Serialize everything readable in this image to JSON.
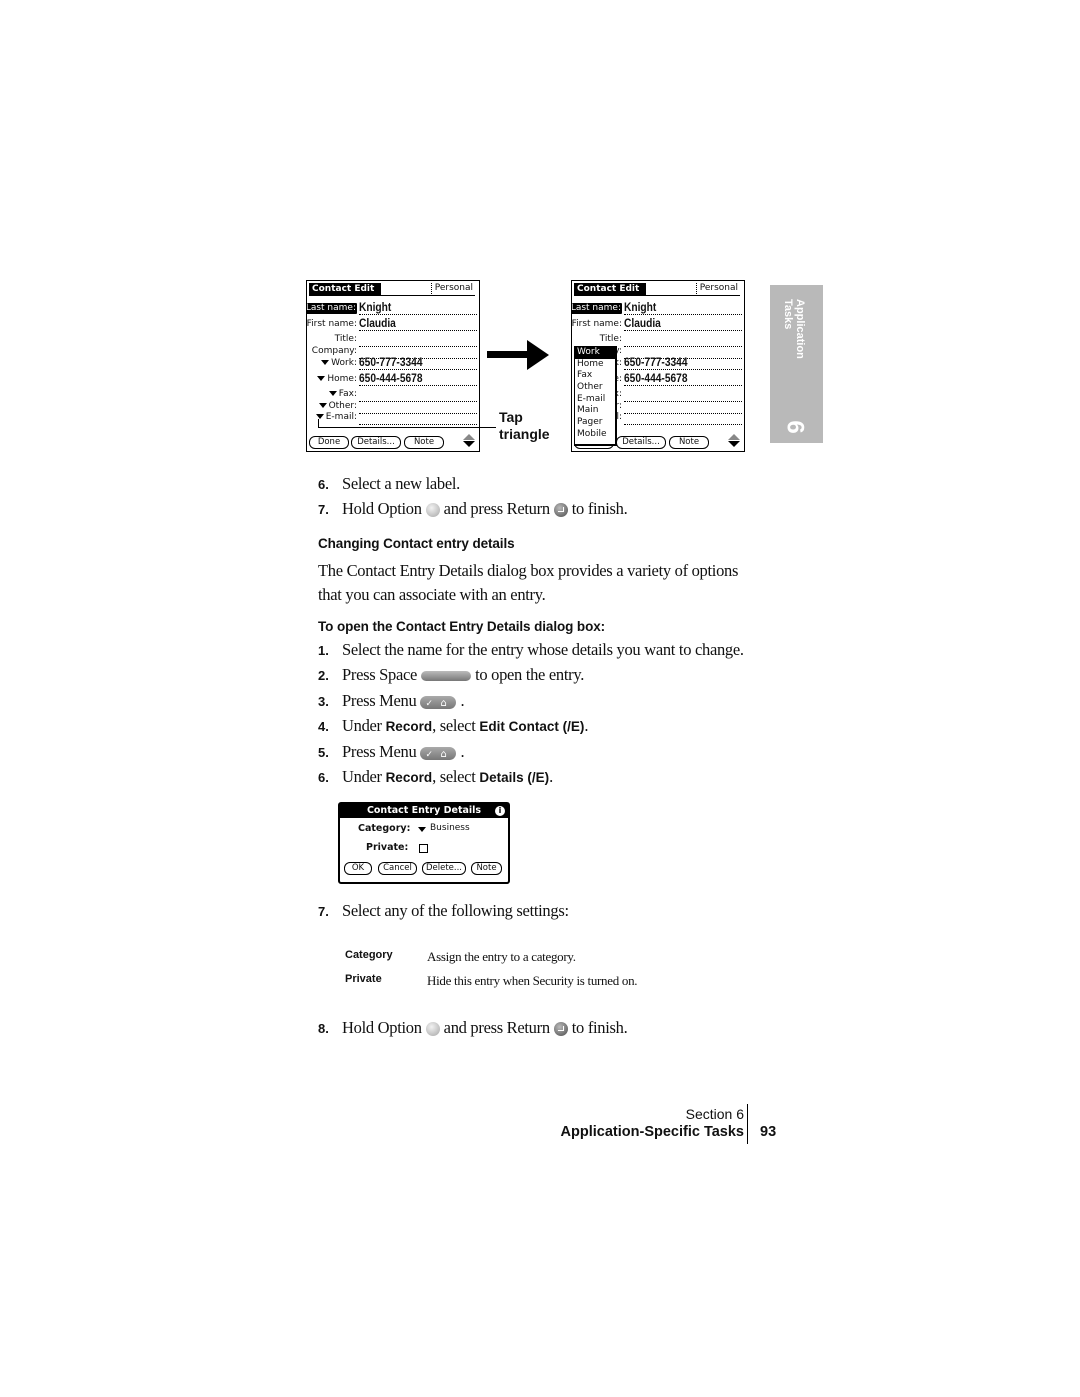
{
  "screens": {
    "left": {
      "title": "Contact Edit",
      "category": "Personal",
      "fields": [
        {
          "label": "Last name:",
          "value": "Knight",
          "highlight": true,
          "triangle": false
        },
        {
          "label": "First name:",
          "value": "Claudia",
          "highlight": false,
          "triangle": false
        },
        {
          "label": "Title:",
          "value": "",
          "highlight": false,
          "triangle": false
        },
        {
          "label": "Company:",
          "value": "",
          "highlight": false,
          "triangle": false
        },
        {
          "label": "Work:",
          "value": "650-777-3344",
          "highlight": false,
          "triangle": true
        },
        {
          "label": "Home:",
          "value": "650-444-5678",
          "highlight": false,
          "triangle": true
        },
        {
          "label": "Fax:",
          "value": "",
          "highlight": false,
          "triangle": true
        },
        {
          "label": "Other:",
          "value": "",
          "highlight": false,
          "triangle": true
        },
        {
          "label": "E-mail:",
          "value": "",
          "highlight": false,
          "triangle": true
        }
      ],
      "buttons": [
        "Done",
        "Details...",
        "Note"
      ]
    },
    "right": {
      "title": "Contact Edit",
      "category": "Personal",
      "popup_items": [
        "Work",
        "Home",
        "Fax",
        "Other",
        "E-mail",
        "Main",
        "Pager",
        "Mobile"
      ],
      "popup_selected": "Work",
      "buttons": [
        "Done",
        "Details...",
        "Note"
      ]
    },
    "callout": {
      "line1": "Tap",
      "line2": "triangle"
    }
  },
  "side_tab": {
    "label_line1": "Application",
    "label_line2": "Tasks",
    "number": "6"
  },
  "steps_a": [
    {
      "num": "6.",
      "text": "Select a new label."
    },
    {
      "num": "7.",
      "pre": "Hold Option",
      "mid": "and press Return",
      "post": "to finish."
    }
  ],
  "section_heading": "Changing Contact entry details",
  "intro": "The Contact Entry Details dialog box provides a variety of options that you can associate with an entry.",
  "procedure_heading": "To open the Contact Entry Details dialog box:",
  "steps_b": [
    {
      "num": "1.",
      "text": "Select the name for the entry whose details you want to change."
    },
    {
      "num": "2.",
      "pre": "Press Space",
      "post": "to open the entry."
    },
    {
      "num": "3.",
      "pre": "Press Menu",
      "post": "."
    },
    {
      "num": "4.",
      "pre": "Under ",
      "bold1": "Record",
      "mid": ", select ",
      "bold2": "Edit Contact (/E)",
      "post": "."
    },
    {
      "num": "5.",
      "pre": "Press Menu",
      "post": "."
    },
    {
      "num": "6.",
      "pre": "Under ",
      "bold1": "Record",
      "mid": ", select ",
      "bold2": "Details (/E)",
      "post": "."
    }
  ],
  "dialog": {
    "title": "Contact Entry Details",
    "info_icon": "i",
    "category_label": "Category:",
    "category_value": "Business",
    "private_label": "Private:",
    "private_checked": false,
    "buttons": [
      "OK",
      "Cancel",
      "Delete...",
      "Note"
    ]
  },
  "step_7b": {
    "num": "7.",
    "text": "Select any of the following settings:"
  },
  "settings": [
    {
      "key": "Category",
      "desc": "Assign the entry to a category."
    },
    {
      "key": "Private",
      "desc": "Hide this entry when Security is turned on."
    }
  ],
  "step_8": {
    "num": "8.",
    "pre": "Hold Option",
    "mid": "and press Return",
    "post": "to finish."
  },
  "footer": {
    "section": "Section 6",
    "chapter": "Application-Specific Tasks",
    "page": "93"
  }
}
